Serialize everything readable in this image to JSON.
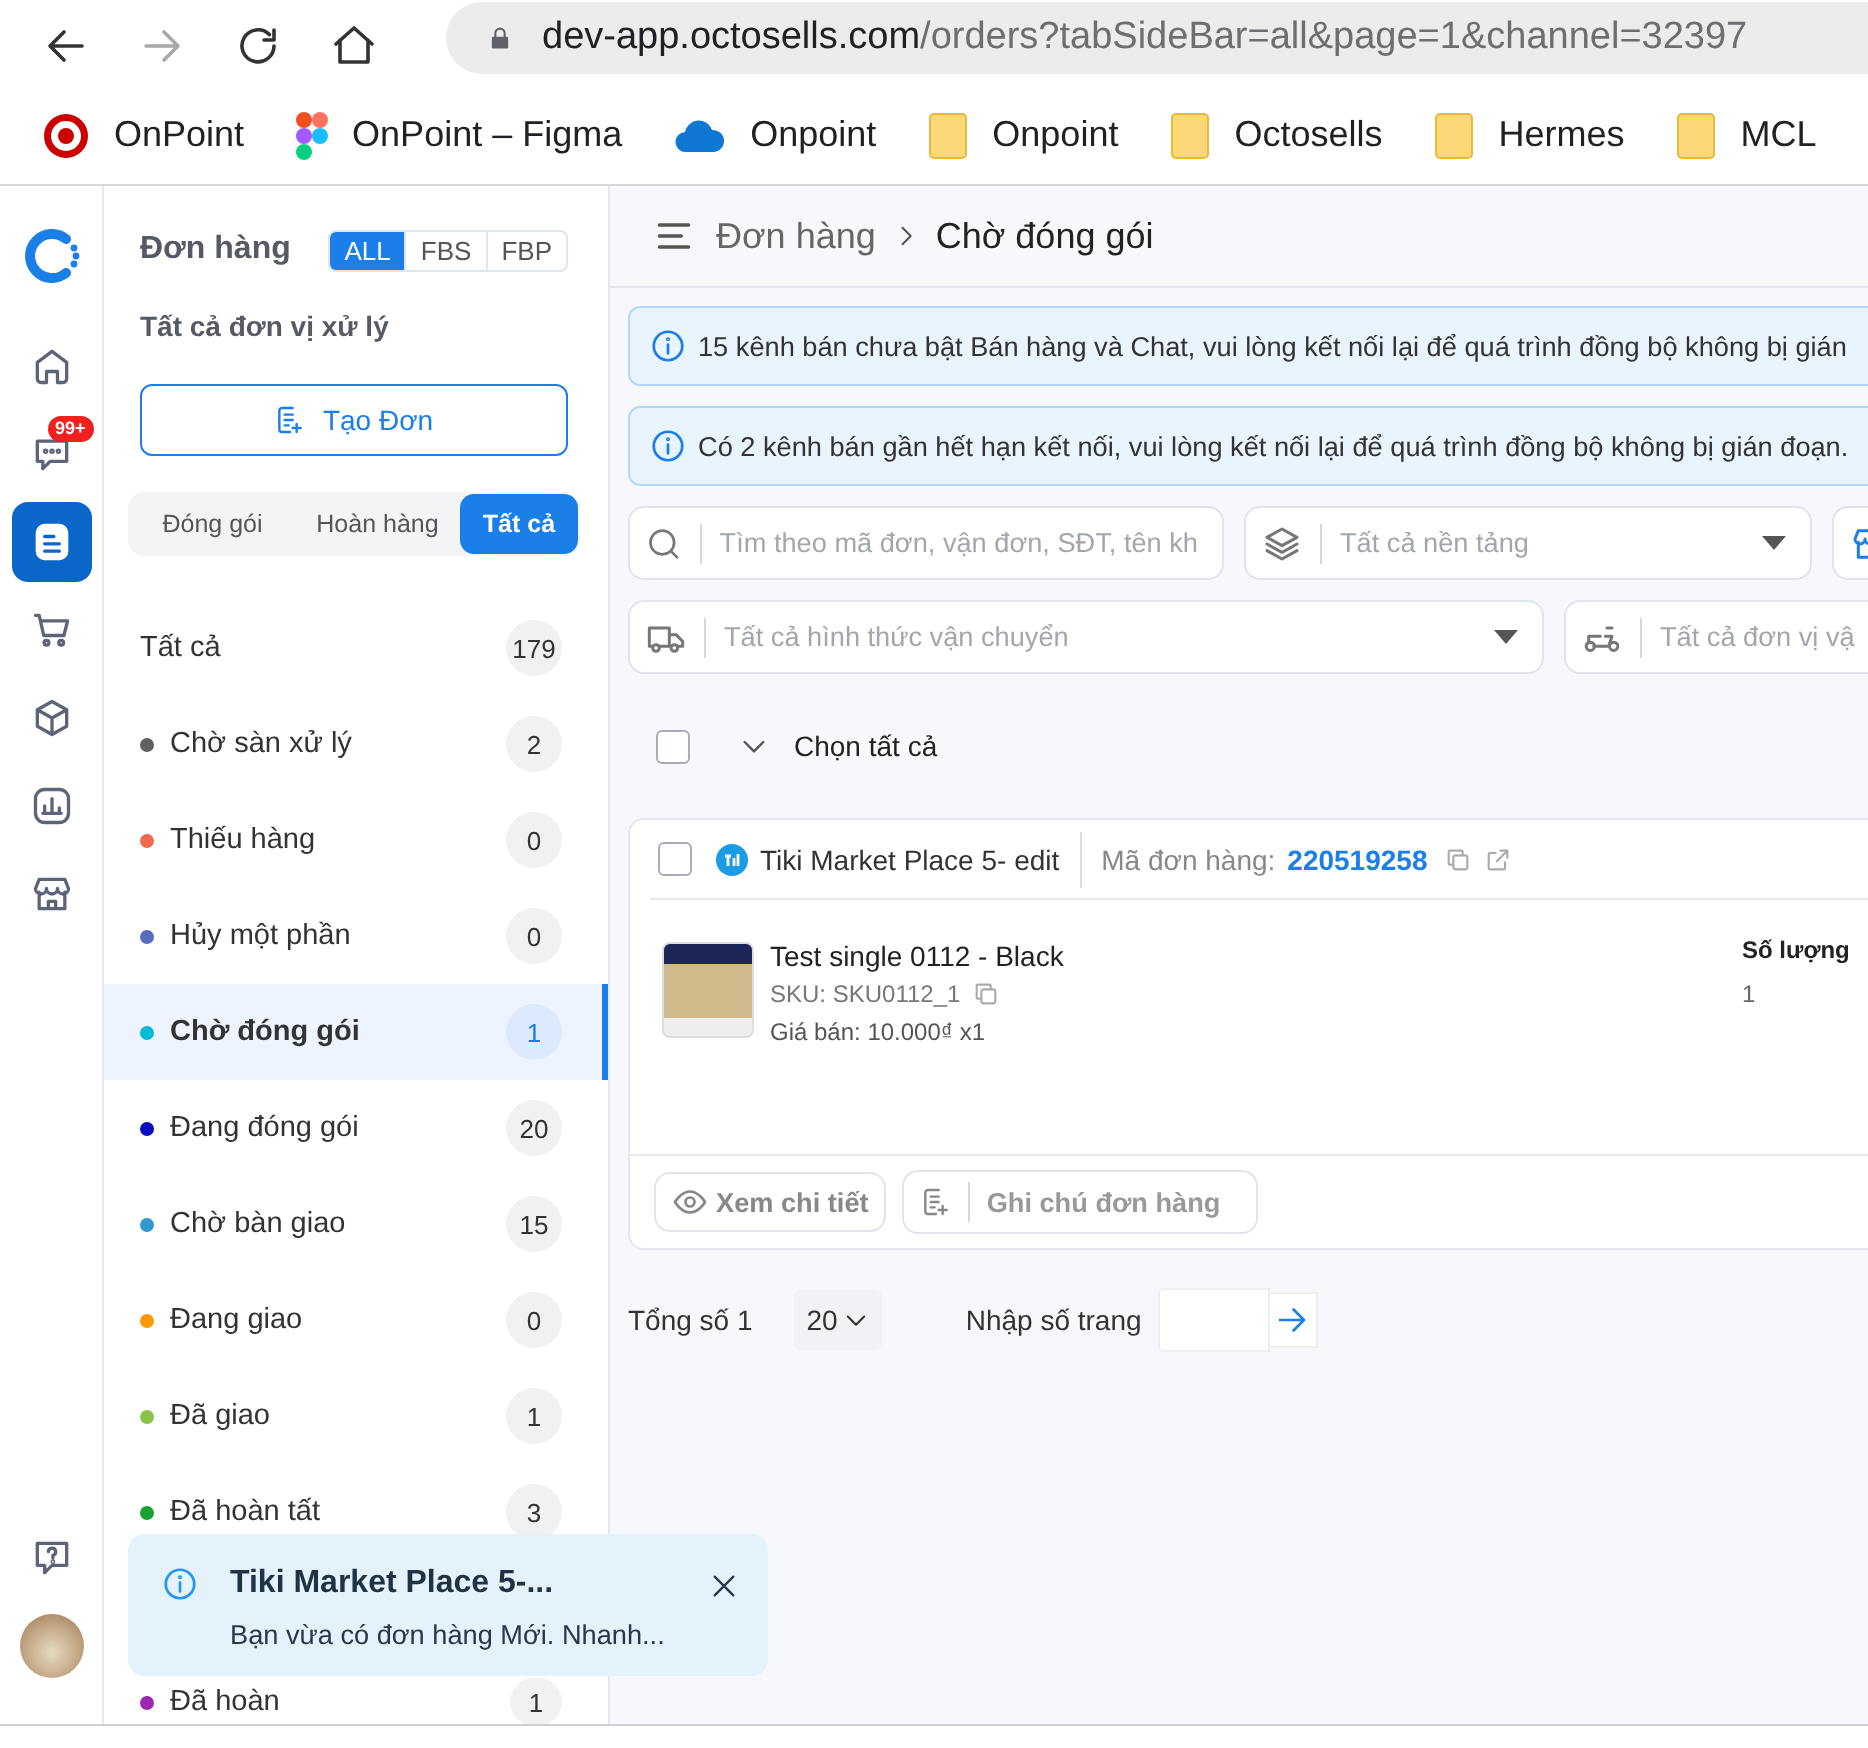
{
  "browser": {
    "back_disabled": false,
    "forward_disabled": true,
    "url_host": "dev-app.octosells.com",
    "url_path": "/orders?tabSideBar=all&page=1&channel=32397",
    "bookmarks": [
      {
        "kind": "target",
        "label": "OnPoint"
      },
      {
        "kind": "figma",
        "label": "OnPoint – Figma"
      },
      {
        "kind": "cloud",
        "label": "Onpoint"
      },
      {
        "kind": "folder",
        "label": "Onpoint"
      },
      {
        "kind": "folder",
        "label": "Octosells"
      },
      {
        "kind": "folder",
        "label": "Hermes"
      },
      {
        "kind": "folder",
        "label": "MCL"
      }
    ]
  },
  "rail": {
    "items": [
      {
        "kind": "home",
        "selected": false
      },
      {
        "kind": "chat",
        "selected": false,
        "badge": "99+"
      },
      {
        "kind": "orders",
        "selected": true
      },
      {
        "kind": "cart",
        "selected": false
      },
      {
        "kind": "box",
        "selected": false
      },
      {
        "kind": "chart",
        "selected": false
      },
      {
        "kind": "store",
        "selected": false
      }
    ],
    "bottom": [
      {
        "kind": "help"
      },
      {
        "kind": "avatar"
      }
    ]
  },
  "sidebar": {
    "title": "Đơn hàng",
    "scope_tabs": [
      {
        "label": "ALL",
        "selected": true
      },
      {
        "label": "FBS",
        "selected": false
      },
      {
        "label": "FBP",
        "selected": false
      }
    ],
    "unit_label": "Tất cả đơn vị xử lý",
    "create_button": "Tạo Đơn",
    "status_tabs": [
      {
        "label": "Đóng gói",
        "selected": false
      },
      {
        "label": "Hoàn hàng",
        "selected": false
      },
      {
        "label": "Tất cả",
        "selected": true
      }
    ],
    "statuses": [
      {
        "label": "Tất cả",
        "count": "179",
        "selected": false
      },
      {
        "label": "Chờ sàn xử lý",
        "count": "2",
        "color": "#616161",
        "selected": false
      },
      {
        "label": "Thiếu hàng",
        "count": "0",
        "color": "#ef6b50",
        "selected": false
      },
      {
        "label": "Hủy một phần",
        "count": "0",
        "color": "#5c6bc0",
        "selected": false
      },
      {
        "label": "Chờ đóng gói",
        "count": "1",
        "color": "#00bcd4",
        "selected": true
      },
      {
        "label": "Đang đóng gói",
        "count": "20",
        "color": "#0d0dbf",
        "selected": false
      },
      {
        "label": "Chờ bàn giao",
        "count": "15",
        "color": "#2e9ad0",
        "selected": false
      },
      {
        "label": "Đang giao",
        "count": "0",
        "color": "#ff9800",
        "selected": false
      },
      {
        "label": "Đã giao",
        "count": "1",
        "color": "#8bc34a",
        "selected": false
      },
      {
        "label": "Đã hoàn tất",
        "count": "3",
        "color": "#1aa333",
        "selected": false
      },
      {
        "label": "Đã hoàn",
        "count": "1",
        "color": "#9c27b0",
        "selected": false
      }
    ]
  },
  "main": {
    "breadcrumb": [
      "Đơn hàng",
      "Chờ đóng gói"
    ],
    "banners": [
      "15 kênh bán chưa bật Bán hàng và Chat, vui lòng kết nối lại để quá trình đồng bộ không bị gián",
      "Có 2 kênh bán gần hết hạn kết nối, vui lòng kết nối lại để quá trình đồng bộ không bị gián đoạn."
    ],
    "filter_rows": [
      [
        {
          "kind": "search",
          "placeholder": "Tìm theo mã đơn, vận đơn, SĐT, tên kh",
          "caret": false
        },
        {
          "kind": "platform",
          "placeholder": "Tất cả nền tảng",
          "caret": true
        },
        {
          "kind": "store",
          "caret": false
        }
      ],
      [
        {
          "kind": "shipping-method",
          "placeholder": "Tất cả hình thức vận chuyển",
          "caret": true
        },
        {
          "kind": "shipping-unit",
          "placeholder": "Tất cả đơn vị vậ",
          "caret": false
        }
      ]
    ],
    "select_all": {
      "label": "Chọn tất cả",
      "checked": false
    },
    "orders": [
      {
        "checked": false,
        "shop": "Tiki Market Place 5- edit",
        "order_label": "Mã đơn hàng:",
        "order_no": "220519258",
        "items": [
          {
            "name": "Test single 0112 - Black",
            "sku": "SKU: SKU0112_1",
            "price": "Giá bán: 10.000₫ x1",
            "qty": "1"
          }
        ],
        "qty_heading": "Số lượng",
        "view_button": "Xem chi tiết",
        "note_placeholder": "Ghi chú đơn hàng"
      }
    ],
    "pagination": {
      "total": "Tổng số 1",
      "page_size": "20",
      "page_label": "Nhập số trang"
    }
  },
  "toast": {
    "title": "Tiki Market Place 5-...",
    "message": "Bạn vừa có đơn hàng Mới. Nhanh..."
  }
}
